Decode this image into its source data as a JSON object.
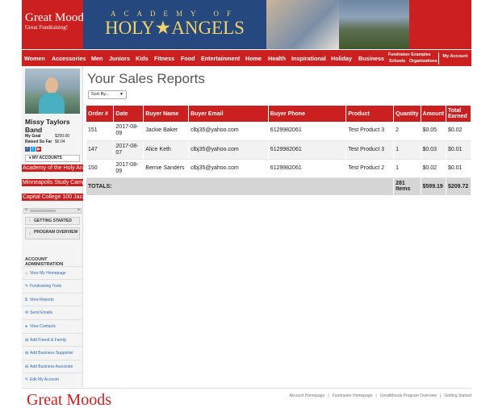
{
  "header": {
    "logo_line1": "Great Moods",
    "logo_line2": "Great Fundraising!",
    "academy_line1": "ACADEMY OF",
    "academy_line2": "HOLY★ANGELS"
  },
  "nav": {
    "items": [
      "Women",
      "Accessories",
      "Men",
      "Juniors",
      "Kids",
      "Fitness",
      "Food",
      "Entertainment",
      "Home",
      "Health",
      "Inspirational",
      "Holiday",
      "Business"
    ],
    "fundraiser_examples": "Fundraiser Examples",
    "schools": "Schools",
    "organizations": "Organizations",
    "my_account": "My Account"
  },
  "sidebar": {
    "user_name": "Missy Taylors Band",
    "my_goal_label": "My Goal",
    "my_goal_value": "$250.00",
    "raised_label": "Raised So Far",
    "raised_value": "$6.04",
    "my_accounts_label": "MY ACCOUNTS",
    "accounts": [
      "Academy of the Holy Angels",
      "Minneapolis Study Camp",
      "Capital College 100 Jazz Band"
    ],
    "getting_started": "GETTING STARTED",
    "program_overview": "PROGRAM OVERVIEW",
    "admin_title": "ACCOUNT ADMINISTRATION",
    "admin_links": [
      {
        "label": "View My Homepage",
        "icon": "home-icon"
      },
      {
        "label": "Fundraising Tools",
        "icon": "wrench-icon"
      },
      {
        "label": "View Reports",
        "icon": "dollar-icon"
      },
      {
        "label": "Send Emails",
        "icon": "envelope-icon"
      },
      {
        "label": "View Contacts",
        "icon": "user-icon"
      },
      {
        "label": "Add Friend & Family",
        "icon": "plus-icon"
      },
      {
        "label": "Add Business Supporter",
        "icon": "plus-icon"
      },
      {
        "label": "Add Business Associate",
        "icon": "plus-icon"
      },
      {
        "label": "Edit My Account",
        "icon": "pencil-icon"
      }
    ]
  },
  "main": {
    "title": "Your Sales Reports",
    "sort_label": "Sort By...",
    "columns": [
      "Order #",
      "Date",
      "Buyer Name",
      "Buyer Email",
      "Buyer Phone",
      "Product",
      "Quantity",
      "Amount",
      "Total Earned"
    ],
    "rows": [
      [
        "151",
        "2017-08-09",
        "Jackie Baker",
        "clbj35@yahoo.com",
        "6129982061",
        "Test Product 3",
        "2",
        "$0.05",
        "$0.02"
      ],
      [
        "147",
        "2017-08-07",
        "Alice Keth",
        "clbj35@yahoo.com",
        "6129982061",
        "Test Product 3",
        "1",
        "$0.03",
        "$0.01"
      ],
      [
        "150",
        "2017-08-09",
        "Bernie Sanders",
        "clbj35@yahoo.com",
        "6129982061",
        "Test Product 2",
        "1",
        "$0.02",
        "$0.01"
      ]
    ],
    "totals_label": "TOTALS:",
    "totals_items": "281 Items",
    "totals_amount": "$599.19",
    "totals_earned": "$209.72"
  },
  "footer": {
    "logo": "Great Moods",
    "links": [
      "Account Homepage",
      "Fundraiser Homepage",
      "GreatMoods Program Overview",
      "Getting Started"
    ]
  },
  "colors": {
    "brand_red": "#cc1f1f",
    "academy_blue": "#25487e",
    "academy_gold": "#f2d26b"
  }
}
